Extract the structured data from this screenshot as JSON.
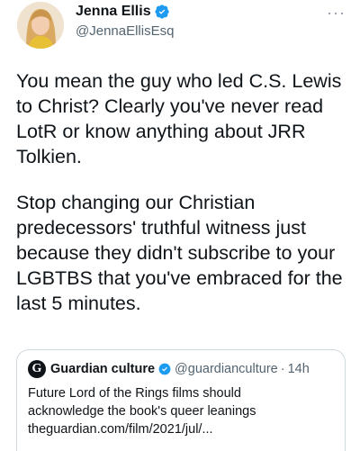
{
  "author": {
    "name": "Jenna Ellis",
    "handle": "@JennaEllisEsq"
  },
  "menu": {
    "more_label": "···"
  },
  "tweet": {
    "paragraph_1": "You mean the guy who led C.S. Lewis\nto Christ? Clearly you've never read\nLotR or know anything about JRR\nTolkien.",
    "paragraph_2": "Stop changing our Christian\npredecessors' truthful witness just\nbecause they didn't subscribe to your\nLGBTBS that you've embraced for the\nlast 5 minutes."
  },
  "quoted_tweet": {
    "logo_letter": "G",
    "name": "Guardian culture",
    "handle": "@guardianculture",
    "separator": "·",
    "time": "14h",
    "text": "Future Lord of the Rings films should\nacknowledge the book's queer leanings\ntheguardian.com/film/2021/jul/..."
  },
  "colors": {
    "verified_blue": "#1d9bf0",
    "text_primary": "#0f1419",
    "text_secondary": "#536471",
    "border": "#cfd9de"
  },
  "icons": {
    "verified": "verified-badge-icon",
    "more": "more-options-icon",
    "guardian_logo": "guardian-logo-icon"
  }
}
